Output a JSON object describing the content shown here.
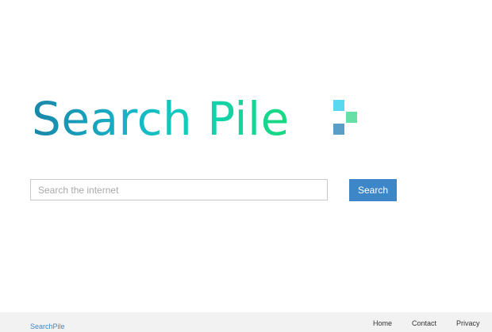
{
  "logo": {
    "text": "Search Pile",
    "mark_colors": [
      "#5ad8f0",
      "#67e0a8",
      "#5a9ec8"
    ]
  },
  "search": {
    "placeholder": "Search the internet",
    "value": "",
    "button_label": "Search"
  },
  "footer": {
    "brand": "SearchPile",
    "links": [
      {
        "label": "Home"
      },
      {
        "label": "Contact"
      },
      {
        "label": "Privacy"
      }
    ]
  },
  "colors": {
    "accent": "#3d87c8",
    "footer_bg": "#f2f2f2",
    "link": "#3d87c8"
  }
}
